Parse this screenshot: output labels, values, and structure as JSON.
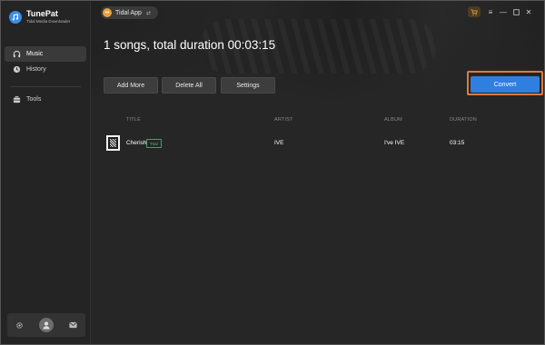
{
  "app": {
    "name": "TunePat",
    "subtitle": "Tidal Media Downloader"
  },
  "sidebar": {
    "items": [
      {
        "label": "Music",
        "icon": "headphones-icon",
        "active": true
      },
      {
        "label": "History",
        "icon": "clock-icon",
        "active": false
      },
      {
        "label": "Tools",
        "icon": "toolbox-icon",
        "active": false
      }
    ],
    "bottom_icons": [
      "gear-icon",
      "user-avatar",
      "mail-icon"
    ]
  },
  "header": {
    "source_label": "Tidal App"
  },
  "summary": "1 songs, total duration 00:03:15",
  "toolbar": {
    "add_more": "Add More",
    "delete_all": "Delete All",
    "settings": "Settings",
    "convert": "Convert"
  },
  "table": {
    "headers": [
      "TITLE",
      "ARTIST",
      "ALBUM",
      "DURATION"
    ],
    "rows": [
      {
        "title": "Cherish",
        "badge": "Trial",
        "artist": "IVE",
        "album": "I've IVE",
        "duration": "03:15"
      }
    ]
  },
  "colors": {
    "accent": "#2f7fe0",
    "highlight": "#e07a3b",
    "trial_badge": "#4cc47f"
  }
}
